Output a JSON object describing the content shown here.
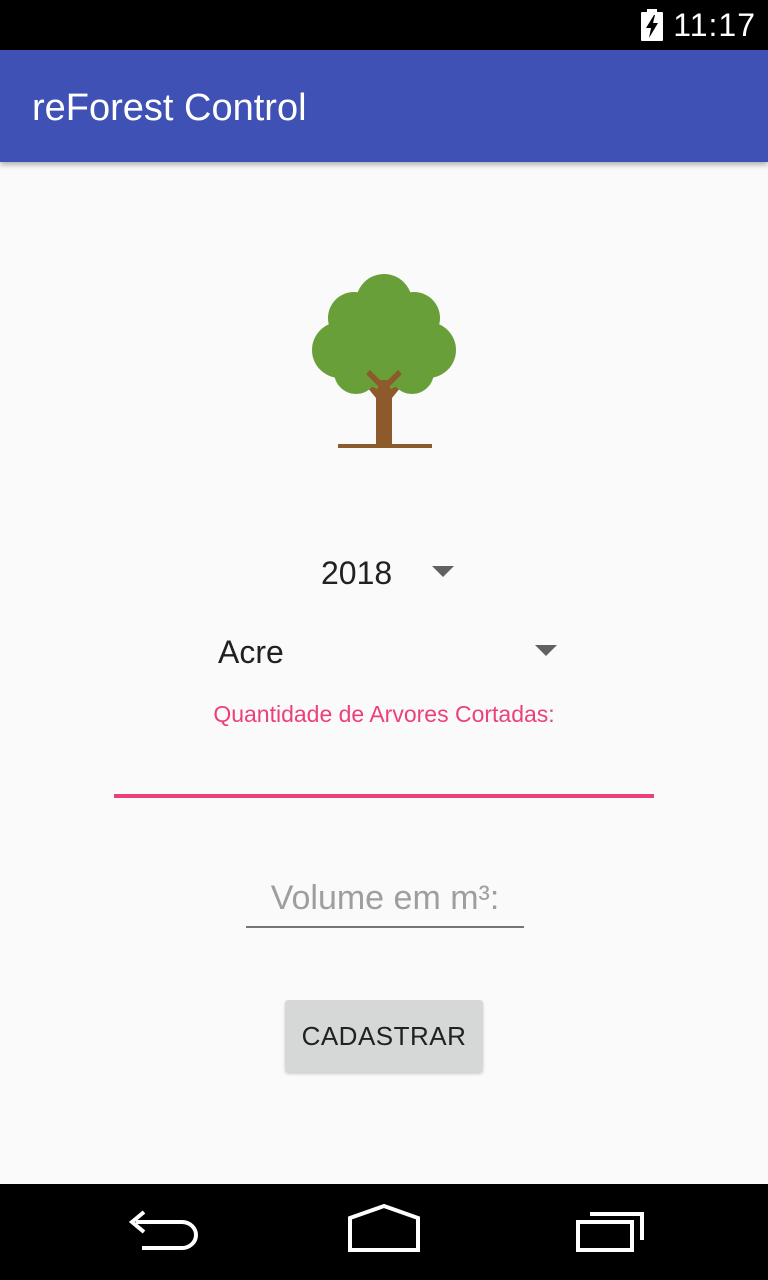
{
  "status_bar": {
    "time": "11:17",
    "icons": [
      "battery-charging-icon"
    ]
  },
  "app_bar": {
    "title": "reForest Control",
    "color": "#3f51b5"
  },
  "header_image": {
    "icon": "tree-icon"
  },
  "form": {
    "year_spinner": {
      "value": "2018"
    },
    "state_spinner": {
      "value": "Acre"
    },
    "trees_cut": {
      "label": "Quantidade de Arvores Cortadas:",
      "value": "",
      "accent_color": "#ec407a"
    },
    "volume": {
      "placeholder": "Volume em m³:",
      "value": ""
    },
    "submit_label": "CADASTRAR"
  },
  "nav_bar": {
    "icons": [
      "back-icon",
      "home-icon",
      "recents-icon"
    ]
  }
}
